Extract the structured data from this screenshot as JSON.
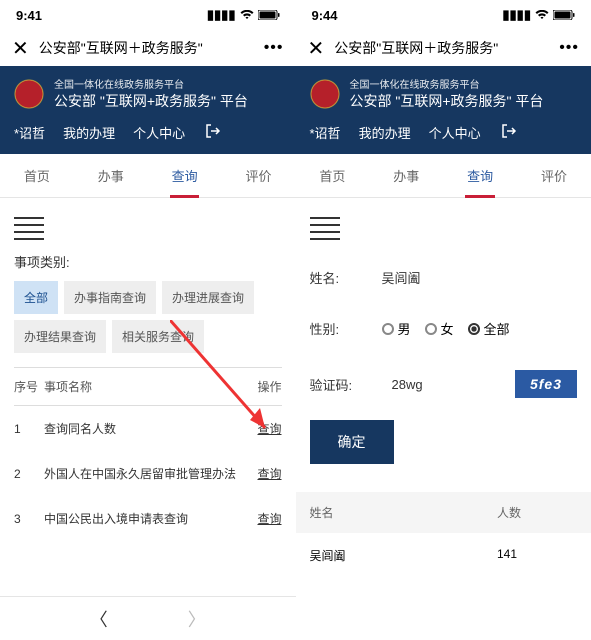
{
  "left": {
    "status": {
      "time": "9:41",
      "signal": "▪▪▪▪",
      "wifi": "📶",
      "battery": "🔋"
    },
    "titlebar": {
      "title": "公安部\"互联网＋政务服务\""
    },
    "header": {
      "small": "全国一体化在线政务服务平台",
      "big": "公安部 \"互联网+政务服务\" 平台",
      "nav": [
        "*诏哲",
        "我的办理",
        "个人中心"
      ]
    },
    "tabs": [
      "首页",
      "办事",
      "查询",
      "评价"
    ],
    "section_label": "事项类别:",
    "filters": [
      "全部",
      "办事指南查询",
      "办理进展查询",
      "办理结果查询",
      "相关服务查询"
    ],
    "table": {
      "headers": {
        "idx": "序号",
        "name": "事项名称",
        "op": "操作"
      },
      "rows": [
        {
          "idx": "1",
          "name": "查询同名人数",
          "op": "查询"
        },
        {
          "idx": "2",
          "name": "外国人在中国永久居留审批管理办法",
          "op": "查询"
        },
        {
          "idx": "3",
          "name": "中国公民出入境申请表查询",
          "op": "查询"
        }
      ]
    }
  },
  "right": {
    "status": {
      "time": "9:44"
    },
    "titlebar": {
      "title": "公安部\"互联网＋政务服务\""
    },
    "header": {
      "small": "全国一体化在线政务服务平台",
      "big": "公安部 \"互联网+政务服务\" 平台",
      "nav": [
        "*诏哲",
        "我的办理",
        "个人中心"
      ]
    },
    "tabs": [
      "首页",
      "办事",
      "查询",
      "评价"
    ],
    "form": {
      "name_label": "姓名:",
      "name_value": "吴闾阖",
      "gender_label": "性别:",
      "gender_opts": [
        "男",
        "女",
        "全部"
      ],
      "captcha_label": "验证码:",
      "captcha_value": "28wg",
      "captcha_img": "5fe3",
      "submit": "确定"
    },
    "result": {
      "headers": {
        "name": "姓名",
        "count": "人数"
      },
      "rows": [
        {
          "name": "吴闾阖",
          "count": "141"
        }
      ]
    }
  }
}
